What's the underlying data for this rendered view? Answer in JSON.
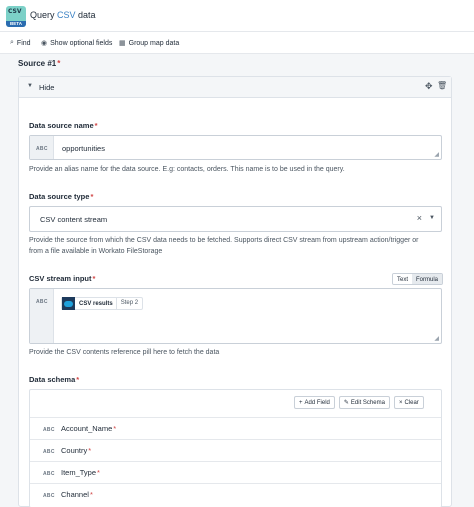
{
  "header": {
    "logo_text": "CSV",
    "logo_badge": "BETA",
    "title_prefix": "Query ",
    "title_accent": "CSV",
    "title_suffix": " data"
  },
  "toolbar": {
    "find_label": "Find",
    "optional_fields_label": "Show optional fields",
    "group_map_label": "Group map data"
  },
  "source": {
    "label": "Source #1",
    "required_mark": "*",
    "hide_label": "Hide"
  },
  "data_source_name": {
    "label": "Data source name",
    "required_mark": "*",
    "type_tag": "ABC",
    "value": "opportunities",
    "hint": "Provide an alias name for the data source. E.g: contacts, orders. This name is to be used in the query."
  },
  "data_source_type": {
    "label": "Data source type",
    "required_mark": "*",
    "value": "CSV content stream",
    "hint_line1": "Provide the source from which the CSV data needs to be fetched. Supports direct CSV stream from upstream action/trigger or",
    "hint_line2": "from a file available in Workato FileStorage"
  },
  "csv_stream_input": {
    "label": "CSV stream input",
    "required_mark": "*",
    "toggle_text": "Text",
    "toggle_formula": "Formula",
    "type_tag": "ABC",
    "pill_label": "CSV results",
    "pill_step": "Step 2",
    "hint": "Provide the CSV contents reference pill here to fetch the data"
  },
  "data_schema": {
    "label": "Data schema",
    "required_mark": "*",
    "add_field": "Add Field",
    "edit_schema": "Edit Schema",
    "clear": "Clear",
    "fields": [
      {
        "type": "ABC",
        "name": "Account_Name",
        "required": "*"
      },
      {
        "type": "ABC",
        "name": "Country",
        "required": "*"
      },
      {
        "type": "ABC",
        "name": "Item_Type",
        "required": "*"
      },
      {
        "type": "ABC",
        "name": "Channel",
        "required": "*"
      }
    ]
  },
  "colors": {
    "accent": "#3b82c4",
    "required": "#d14343",
    "salesforce": "#1ea1dc"
  },
  "icons": {
    "find": "search-icon",
    "optional_fields": "eye-icon",
    "group_map": "grid-icon",
    "collapse": "chevron-down-icon",
    "move": "move-icon",
    "delete": "trash-icon"
  }
}
